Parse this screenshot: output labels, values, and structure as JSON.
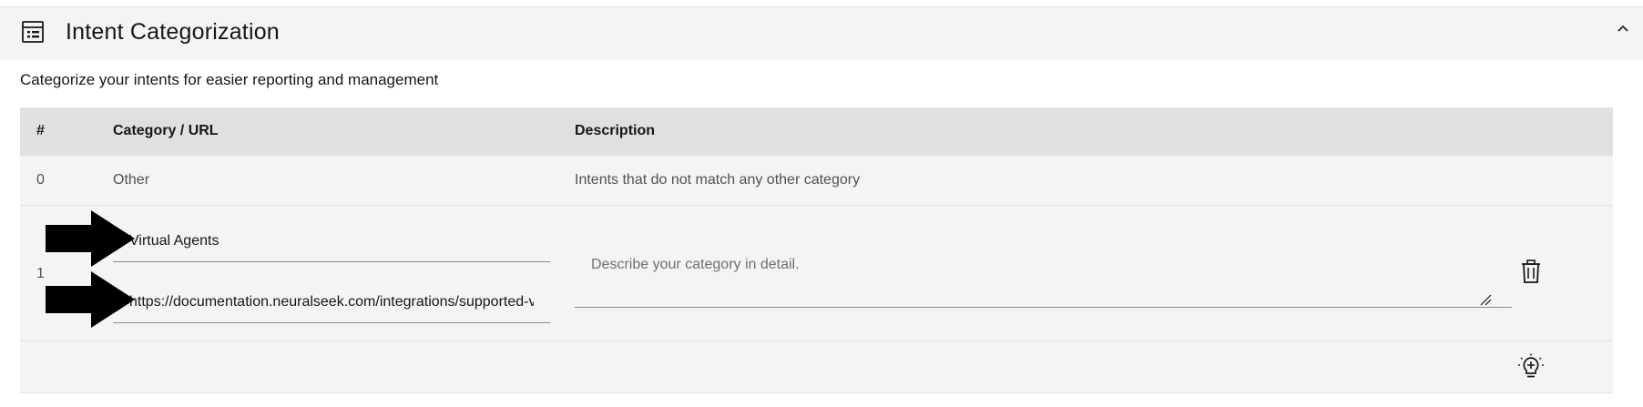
{
  "section": {
    "title": "Intent Categorization",
    "subtitle": "Categorize your intents for easier reporting and management",
    "icon": "table-icon",
    "collapse_icon": "chevron-up-icon"
  },
  "table": {
    "columns": [
      "#",
      "Category / URL",
      "Description"
    ],
    "rows": [
      {
        "index": "0",
        "category": "Other",
        "description": "Intents that do not match any other category"
      }
    ],
    "edit_row": {
      "index": "1",
      "category_value": "Virtual Agents",
      "url_value": "https://documentation.neuralseek.com/integrations/supported-virtual-agents",
      "description_placeholder": "Describe your category in detail.",
      "delete_icon": "trash-icon"
    },
    "add_icon": "lightbulb-add-icon"
  },
  "colors": {
    "header_bg": "#f4f4f4",
    "table_head_bg": "#e0e0e0",
    "row_bg": "#f4f4f4",
    "text": "#161616",
    "muted_text": "#525252",
    "annotation_arrow": "#000000"
  }
}
